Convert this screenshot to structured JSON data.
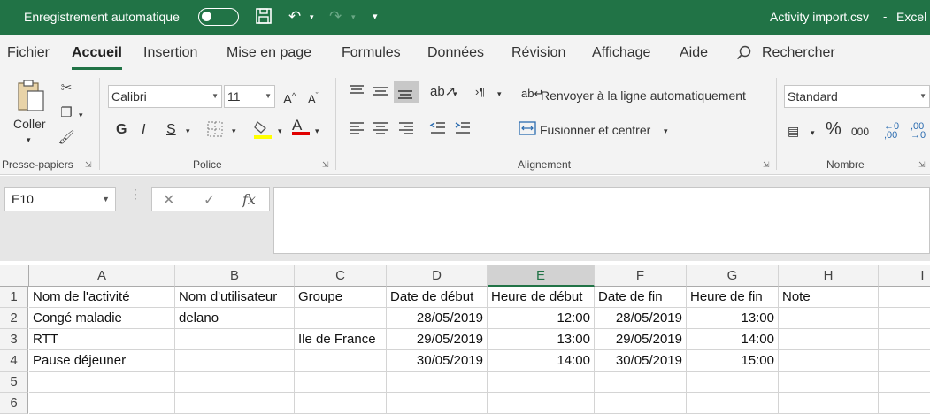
{
  "titlebar": {
    "autosave_label": "Enregistrement automatique",
    "title": "Activity import.csv",
    "app": "Excel"
  },
  "tabs": [
    "Fichier",
    "Accueil",
    "Insertion",
    "Mise en page",
    "Formules",
    "Données",
    "Révision",
    "Affichage",
    "Aide"
  ],
  "search_label": "Rechercher",
  "ribbon": {
    "paste_label": "Coller",
    "font_name": "Calibri",
    "font_size": "11",
    "bold": "G",
    "italic": "I",
    "underline": "S",
    "wrap_label": "Renvoyer à la ligne automatiquement",
    "merge_label": "Fusionner et centrer",
    "number_format": "Standard",
    "percent": "%",
    "thousands": "000",
    "groups": {
      "clipboard": "Presse-papiers",
      "font": "Police",
      "alignment": "Alignement",
      "number": "Nombre"
    }
  },
  "formula_bar": {
    "name_box": "E10",
    "formula": ""
  },
  "sheet": {
    "columns": [
      "A",
      "B",
      "C",
      "D",
      "E",
      "F",
      "G",
      "H",
      "I"
    ],
    "row_numbers": [
      "1",
      "2",
      "3",
      "4",
      "5",
      "6"
    ],
    "rows": [
      [
        "Nom de l'activité",
        "Nom d'utilisateur",
        "Groupe",
        "Date de début",
        "Heure de début",
        "Date de fin",
        "Heure de fin",
        "Note",
        ""
      ],
      [
        "Congé maladie",
        "delano",
        "",
        "28/05/2019",
        "12:00",
        "28/05/2019",
        "13:00",
        "",
        ""
      ],
      [
        "RTT",
        "",
        "Ile de France",
        "29/05/2019",
        "13:00",
        "29/05/2019",
        "14:00",
        "",
        ""
      ],
      [
        "Pause déjeuner",
        "",
        "",
        "30/05/2019",
        "14:00",
        "30/05/2019",
        "15:00",
        "",
        ""
      ],
      [
        "",
        "",
        "",
        "",
        "",
        "",
        "",
        "",
        ""
      ],
      [
        "",
        "",
        "",
        "",
        "",
        "",
        "",
        "",
        ""
      ]
    ]
  },
  "colors": {
    "excel_green": "#217346"
  }
}
